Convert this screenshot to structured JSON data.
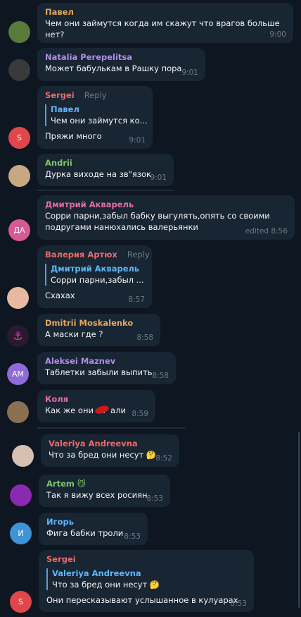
{
  "colors": {
    "background": "#0e1621",
    "bubble": "#182533",
    "meta": "#6c7883",
    "quote_bar": "#5e9cd7"
  },
  "messages": [
    {
      "sender": "Павел",
      "sender_color": "#e3a85b",
      "text": "Чем они займутся когда им скажут что врагов больше нет?",
      "time": "9:00",
      "avatar_kind": "photo",
      "avatar_color": "#5a7a3c"
    },
    {
      "sender": "Natalia Perepelitsa",
      "sender_color": "#b18ce8",
      "text": "Может бабулькам в Рашку пора",
      "time": "9:01",
      "avatar_kind": "photo",
      "avatar_color": "#3a3a3a"
    },
    {
      "sender": "Sergei",
      "sender_color": "#e96a6a",
      "reply_label": "Reply",
      "quote_name": "Павел",
      "quote_text": "Чем они займутся ко...",
      "text": "Пряжи много",
      "time": "9:01",
      "avatar_kind": "initials",
      "avatar_initials": "S",
      "avatar_color": "#e0474a"
    },
    {
      "sender": "Andrii",
      "sender_color": "#7ec66a",
      "text": "Дурка виходе на зв\"язок",
      "time": "9:01",
      "avatar_kind": "photo",
      "avatar_color": "#c8a880"
    },
    {
      "sender": "Дмитрий Акварель",
      "sender_color": "#e66ba4",
      "text": "Сорри парни,забыл бабку выгулять,опять со своими подругами нанюхались валерьянки",
      "time": "edited 8:56",
      "avatar_kind": "initials",
      "avatar_initials": "ДА",
      "avatar_color": "#d85a93"
    },
    {
      "sender": "Валерия Артюх",
      "sender_color": "#e96a6a",
      "reply_label": "Reply",
      "quote_name": "Дмитрий Акварель",
      "quote_text": "Сорри парни,забыл ...",
      "text": "Схахах",
      "time": "8:57",
      "avatar_kind": "photo",
      "avatar_color": "#e8b8a0"
    },
    {
      "sender": "Dmitrii Moskalenko",
      "sender_color": "#e3a85b",
      "text": "А маски где ?",
      "time": "8:58",
      "avatar_kind": "photo",
      "avatar_color": "#2a1a30"
    },
    {
      "sender": "Aleksei Maznev",
      "sender_color": "#b18ce8",
      "text": "Таблетки забыли выпить",
      "time": "8:58",
      "avatar_kind": "initials",
      "avatar_initials": "AM",
      "avatar_color": "#8e6bd8"
    },
    {
      "sender": "Коля",
      "sender_color": "#e66ba4",
      "text": "Как же они за  али",
      "time": "8:59",
      "avatar_kind": "photo",
      "avatar_color": "#8a7050"
    },
    {
      "sender": "Valeriya Andreevna",
      "sender_color": "#e96a6a",
      "text": "Что за бред они несут 🤔",
      "time": "8:52",
      "avatar_kind": "photo",
      "avatar_color": "#d8c0b0"
    },
    {
      "sender": "Artem 😼",
      "sender_color": "#7ec66a",
      "text": "Так я вижу всех росиян",
      "time": "8:53",
      "avatar_kind": "photo",
      "avatar_color": "#8a2ab0"
    },
    {
      "sender": "Игорь",
      "sender_color": "#5eb5f7",
      "text": "Фига бабки троли",
      "time": "8:53",
      "avatar_kind": "initials",
      "avatar_initials": "И",
      "avatar_color": "#3d94d6"
    },
    {
      "sender": "Sergei",
      "sender_color": "#e96a6a",
      "quote_name": "Valeriya Andreevna",
      "quote_text": "Что за бред они несут 🤔",
      "text": "Они пересказывают услышанное в кулуарах",
      "time": "8:53",
      "avatar_kind": "initials",
      "avatar_initials": "S",
      "avatar_color": "#e0474a"
    }
  ]
}
